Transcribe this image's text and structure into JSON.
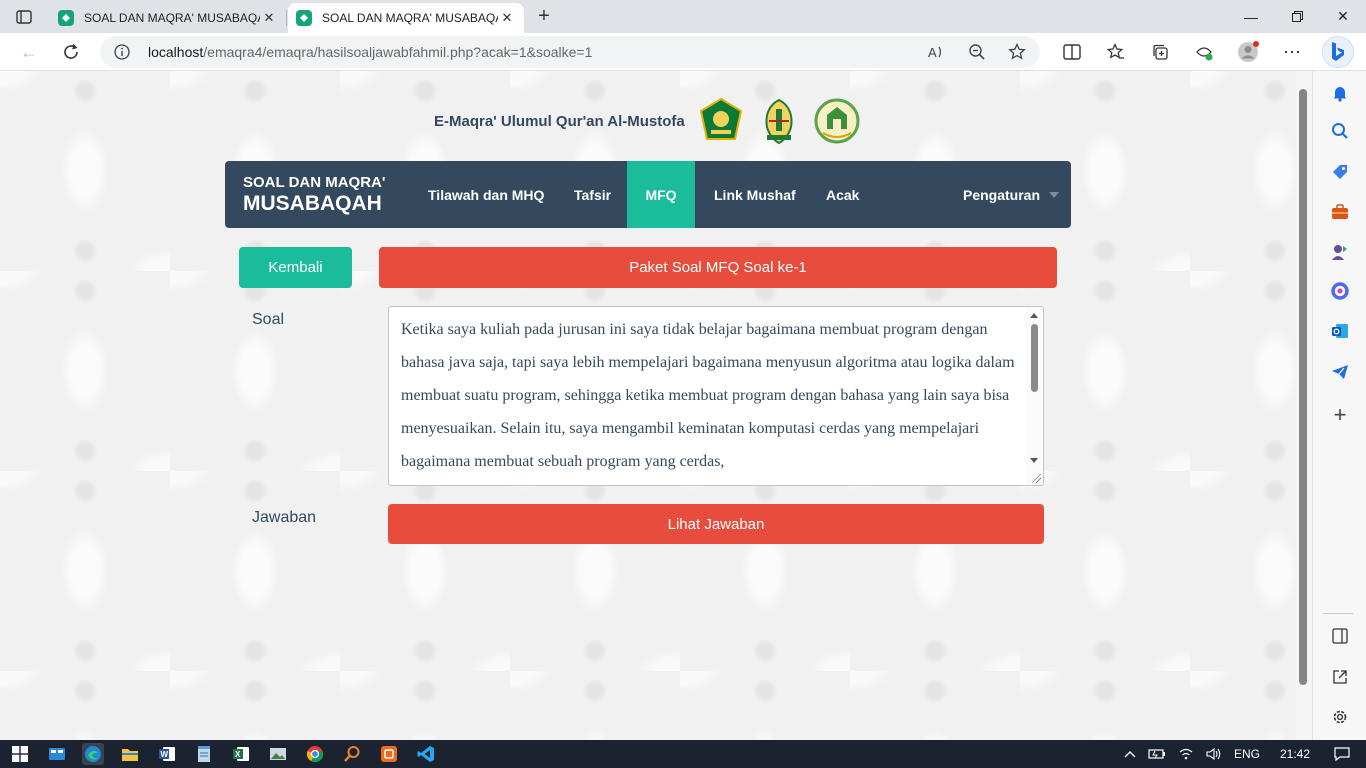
{
  "browser": {
    "tabs": [
      {
        "title": "SOAL DAN MAQRA' MUSABAQAH",
        "active": false
      },
      {
        "title": "SOAL DAN MAQRA' MUSABAQAH",
        "active": true
      }
    ],
    "url_host": "localhost",
    "url_path": "/emaqra4/emaqra/hasilsoaljawabfahmil.php?acak=1&soalke=1"
  },
  "site": {
    "title": "E-Maqra' Ulumul Qur'an Al-Mustofa",
    "logos": [
      "kemenag-logo",
      "regional-emblem-logo",
      "institution-logo"
    ]
  },
  "navbar": {
    "brand_line1": "SOAL DAN MAQRA'",
    "brand_line2": "MUSABAQAH",
    "items": [
      "Tilawah dan MHQ",
      "Tafsir",
      "MFQ",
      "Link Mushaf",
      "Acak"
    ],
    "active_item": "MFQ",
    "settings": "Pengaturan"
  },
  "content": {
    "back_button": "Kembali",
    "packet_title": "Paket Soal MFQ Soal ke-1",
    "soal_label": "Soal",
    "soal_text": "Ketika saya kuliah pada jurusan ini saya tidak belajar bagaimana membuat program dengan bahasa java saja, tapi saya lebih mempelajari bagaimana menyusun algoritma atau logika dalam membuat suatu program, sehingga ketika membuat program dengan bahasa yang lain saya bisa menyesuaikan. Selain itu, saya mengambil keminatan komputasi cerdas yang mempelajari bagaimana membuat sebuah program yang cerdas,",
    "jawaban_label": "Jawaban",
    "show_answer_button": "Lihat Jawaban"
  },
  "taskbar": {
    "language": "ENG",
    "time": "21:42"
  },
  "colors": {
    "navbar": "#34495e",
    "accent_green": "#1abc9c",
    "accent_red": "#e74c3c"
  }
}
